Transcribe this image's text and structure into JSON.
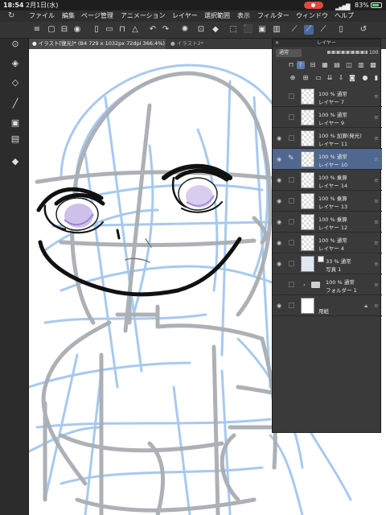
{
  "status": {
    "time": "18:54",
    "date": "2月1日(水)",
    "signal": "▂▄▆█",
    "battery": "83%"
  },
  "menu": {
    "logo_icon": "clip-studio-logo-icon",
    "items": [
      "ファイル",
      "編集",
      "ページ管理",
      "アニメーション",
      "レイヤー",
      "選択範囲",
      "表示",
      "フィルター",
      "ウィンドウ",
      "ヘルプ"
    ]
  },
  "tabs": {
    "active": "● イラスト[復元]* (B4 729 x 1032px 72dpi 366.4%)",
    "inactive": "● イラスト2*"
  },
  "layer_panel": {
    "title": "レイヤー",
    "close": "✕",
    "blend_mode": "通常",
    "opacity": "100",
    "layers": [
      {
        "line1": "100 % 通常",
        "line2": "レイヤー 7",
        "visible": false,
        "kind": "raster"
      },
      {
        "line1": "100 % 通常",
        "line2": "レイヤー 9",
        "visible": false,
        "kind": "raster"
      },
      {
        "line1": "100 % 加算(発光)",
        "line2": "レイヤー 11",
        "visible": true,
        "kind": "raster"
      },
      {
        "line1": "100 % 通常",
        "line2": "レイヤー 10",
        "visible": true,
        "kind": "raster",
        "selected": true
      },
      {
        "line1": "100 % 乗算",
        "line2": "レイヤー 14",
        "visible": true,
        "kind": "raster"
      },
      {
        "line1": "100 % 乗算",
        "line2": "レイヤー 13",
        "visible": true,
        "kind": "raster"
      },
      {
        "line1": "100 % 乗算",
        "line2": "レイヤー 12",
        "visible": true,
        "kind": "raster"
      },
      {
        "line1": "100 % 通常",
        "line2": "レイヤー 4",
        "visible": true,
        "kind": "raster"
      },
      {
        "line1": "33 % 通常",
        "line2": "写真 1",
        "visible": true,
        "kind": "photo"
      },
      {
        "line1": "100 % 通常",
        "line2": "フォルダー 1",
        "visible": false,
        "kind": "folder"
      },
      {
        "line1": "",
        "line2": "用紙",
        "visible": true,
        "kind": "paper"
      }
    ]
  },
  "colors": {
    "sketch_blue": "#9ec4ee",
    "sketch_gray": "#a9adb3",
    "ink": "#111111",
    "iris": "#b9a6e0",
    "selected_layer": "#50688f"
  }
}
